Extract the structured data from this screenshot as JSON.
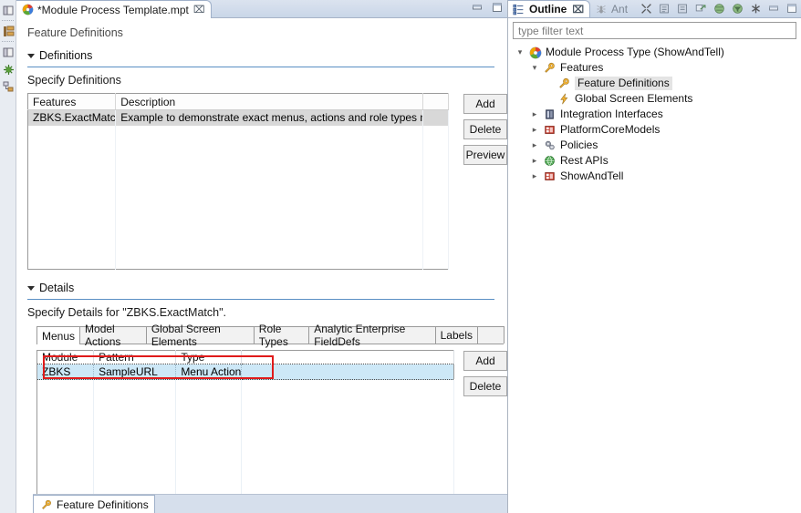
{
  "fastbar": {
    "icons": [
      "perspective-icon",
      "outline-view-icon",
      "view-icon",
      "debug-icon",
      "hierarchy-icon"
    ]
  },
  "editor": {
    "tab": {
      "icon": "module-process-type-icon",
      "title": "*Module Process Template.mpt",
      "close": "⌧"
    },
    "window_buttons": [
      {
        "name": "minimize-editor-button",
        "glyph": "minimize"
      },
      {
        "name": "maximize-editor-button",
        "glyph": "maximize"
      }
    ],
    "form_title": "Feature Definitions",
    "definitions_section": {
      "header": "Definitions",
      "sub_label": "Specify Definitions",
      "table": {
        "columns": [
          "Features",
          "Description"
        ],
        "rows": [
          {
            "features": "ZBKS.ExactMatch",
            "description": "Example to demonstrate exact menus, actions and role types match",
            "selected": true
          }
        ]
      },
      "buttons": [
        "Add",
        "Delete",
        "Preview"
      ]
    },
    "details_section": {
      "header": "Details",
      "sub_label": "Specify Details for \"ZBKS.ExactMatch\".",
      "tabs": [
        {
          "label": "Menus",
          "active": true
        },
        {
          "label": "Model Actions",
          "active": false
        },
        {
          "label": "Global Screen Elements",
          "active": false
        },
        {
          "label": "Role Types",
          "active": false
        },
        {
          "label": "Analytic Enterprise FieldDefs",
          "active": false
        },
        {
          "label": "Labels",
          "active": false
        }
      ],
      "table": {
        "columns": [
          "Module",
          "Pattern",
          "Type"
        ],
        "rows": [
          {
            "module": "ZBKS",
            "pattern": "SampleURL",
            "type": "Menu Action",
            "selected": true
          }
        ]
      },
      "buttons": [
        "Add",
        "Delete"
      ],
      "annotation": {
        "name": "red-highlight-rectangle",
        "color": "#e01b1b"
      }
    },
    "bottom_tab": {
      "icon": "wrench-icon",
      "label": "Feature Definitions"
    }
  },
  "outline": {
    "tabs": [
      {
        "label": "Outline",
        "icon": "outline-icon",
        "active": true,
        "close": "⌧"
      },
      {
        "label": "Ant",
        "icon": "ant-icon",
        "active": false
      }
    ],
    "toolbar": [
      "collapse-all-icon",
      "expand-node-icon",
      "collapse-node-icon",
      "link-with-editor-icon",
      "sort-icon",
      "filter-icon",
      "hide-fields-icon",
      "minimize-view-icon",
      "maximize-view-icon"
    ],
    "filter": {
      "placeholder": "type filter text",
      "value": ""
    },
    "tree": [
      {
        "label": "Module Process Type (ShowAndTell)",
        "icon": "module-process-type-icon",
        "indent": 0,
        "expander": "expanded",
        "selected": false
      },
      {
        "label": "Features",
        "icon": "wrench-icon",
        "indent": 1,
        "expander": "expanded",
        "selected": false
      },
      {
        "label": "Feature Definitions",
        "icon": "wrench-icon",
        "indent": 2,
        "expander": "none",
        "selected": true
      },
      {
        "label": "Global Screen Elements",
        "icon": "lightning-icon",
        "indent": 2,
        "expander": "none",
        "selected": false
      },
      {
        "label": "Integration Interfaces",
        "icon": "interface-icon",
        "indent": 1,
        "expander": "collapsed",
        "selected": false
      },
      {
        "label": "PlatformCoreModels",
        "icon": "model-icon",
        "indent": 1,
        "expander": "collapsed",
        "selected": false
      },
      {
        "label": "Policies",
        "icon": "gears-icon",
        "indent": 1,
        "expander": "collapsed",
        "selected": false
      },
      {
        "label": "Rest APIs",
        "icon": "globe-icon",
        "indent": 1,
        "expander": "collapsed",
        "selected": false
      },
      {
        "label": "ShowAndTell",
        "icon": "model-icon",
        "indent": 1,
        "expander": "collapsed",
        "selected": false
      }
    ]
  }
}
